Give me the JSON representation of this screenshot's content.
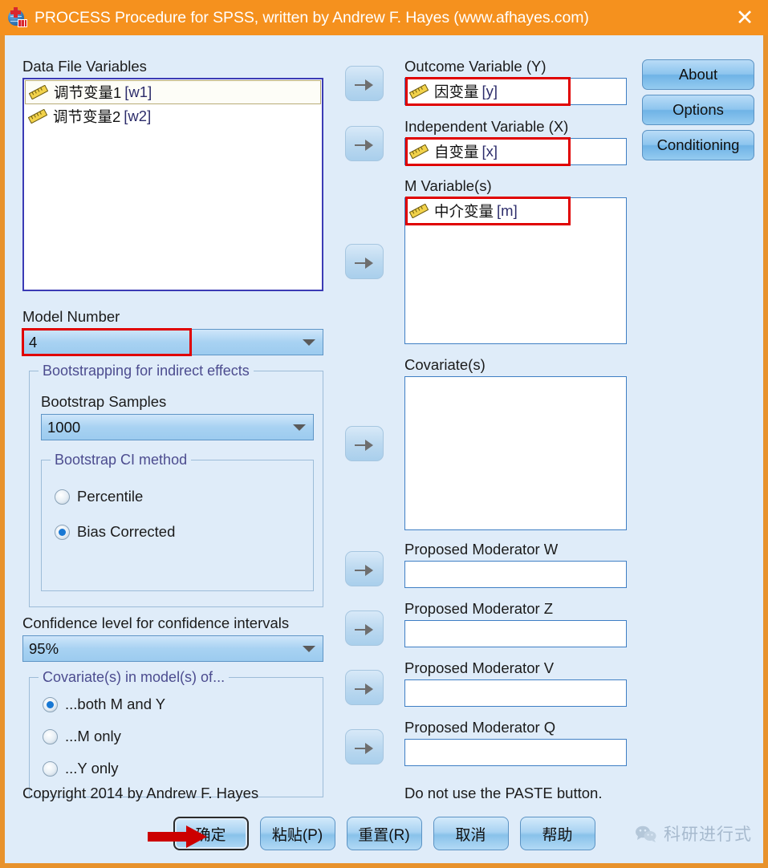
{
  "window": {
    "title": "PROCESS Procedure for SPSS, written by Andrew F. Hayes (www.afhayes.com)",
    "close_label": "✕",
    "titlebar_color": "#f5911e",
    "background_color": "#dfecf9"
  },
  "left": {
    "data_file_variables_label": "Data File Variables",
    "variables": [
      {
        "name": "调节变量1",
        "code": "[w1]",
        "selected": true
      },
      {
        "name": "调节变量2",
        "code": "[w2]",
        "selected": false
      }
    ],
    "model_number_label": "Model Number",
    "model_number_value": "4",
    "bootstrapping_group_label": "Bootstrapping for indirect effects",
    "bootstrap_samples_label": "Bootstrap Samples",
    "bootstrap_samples_value": "1000",
    "bootstrap_ci_group_label": "Bootstrap CI method",
    "ci_methods": [
      {
        "label": "Percentile",
        "selected": false
      },
      {
        "label": "Bias Corrected",
        "selected": true
      }
    ],
    "confidence_level_label": "Confidence level for confidence intervals",
    "confidence_level_value": "95%",
    "covariate_group_label": "Covariate(s) in model(s) of...",
    "covariate_options": [
      {
        "label": "...both M and Y",
        "selected": true
      },
      {
        "label": "...M only",
        "selected": false
      },
      {
        "label": "...Y only",
        "selected": false
      }
    ],
    "copyright": "Copyright 2014 by Andrew F. Hayes"
  },
  "center": {
    "outcome_label": "Outcome Variable (Y)",
    "outcome_value": {
      "name": "因变量",
      "code": "[y]"
    },
    "independent_label": "Independent Variable (X)",
    "independent_value": {
      "name": "自变量",
      "code": "[x]"
    },
    "m_variables_label": "M Variable(s)",
    "m_variables": [
      {
        "name": "中介变量",
        "code": "[m]"
      }
    ],
    "covariates_label": "Covariate(s)",
    "covariates": [],
    "moderator_w_label": "Proposed Moderator W",
    "moderator_w_value": "",
    "moderator_z_label": "Proposed Moderator Z",
    "moderator_z_value": "",
    "moderator_v_label": "Proposed Moderator V",
    "moderator_v_value": "",
    "moderator_q_label": "Proposed Moderator Q",
    "moderator_q_value": "",
    "paste_warning": "Do not use the PASTE button."
  },
  "right_buttons": {
    "about": "About",
    "options": "Options",
    "conditioning": "Conditioning"
  },
  "bottom_buttons": [
    {
      "label": "确定",
      "focused": true
    },
    {
      "label": "粘贴(P)",
      "focused": false
    },
    {
      "label": "重置(R)",
      "focused": false
    },
    {
      "label": "取消",
      "focused": false
    },
    {
      "label": "帮助",
      "focused": false
    }
  ],
  "annotations": {
    "highlight_color": "#e00000",
    "arrow_color": "#cc0000",
    "highlighted_fields": [
      "outcome",
      "independent",
      "m-variables",
      "model-number"
    ],
    "arrow_target": "确定"
  },
  "watermark": {
    "text": "科研进行式"
  }
}
